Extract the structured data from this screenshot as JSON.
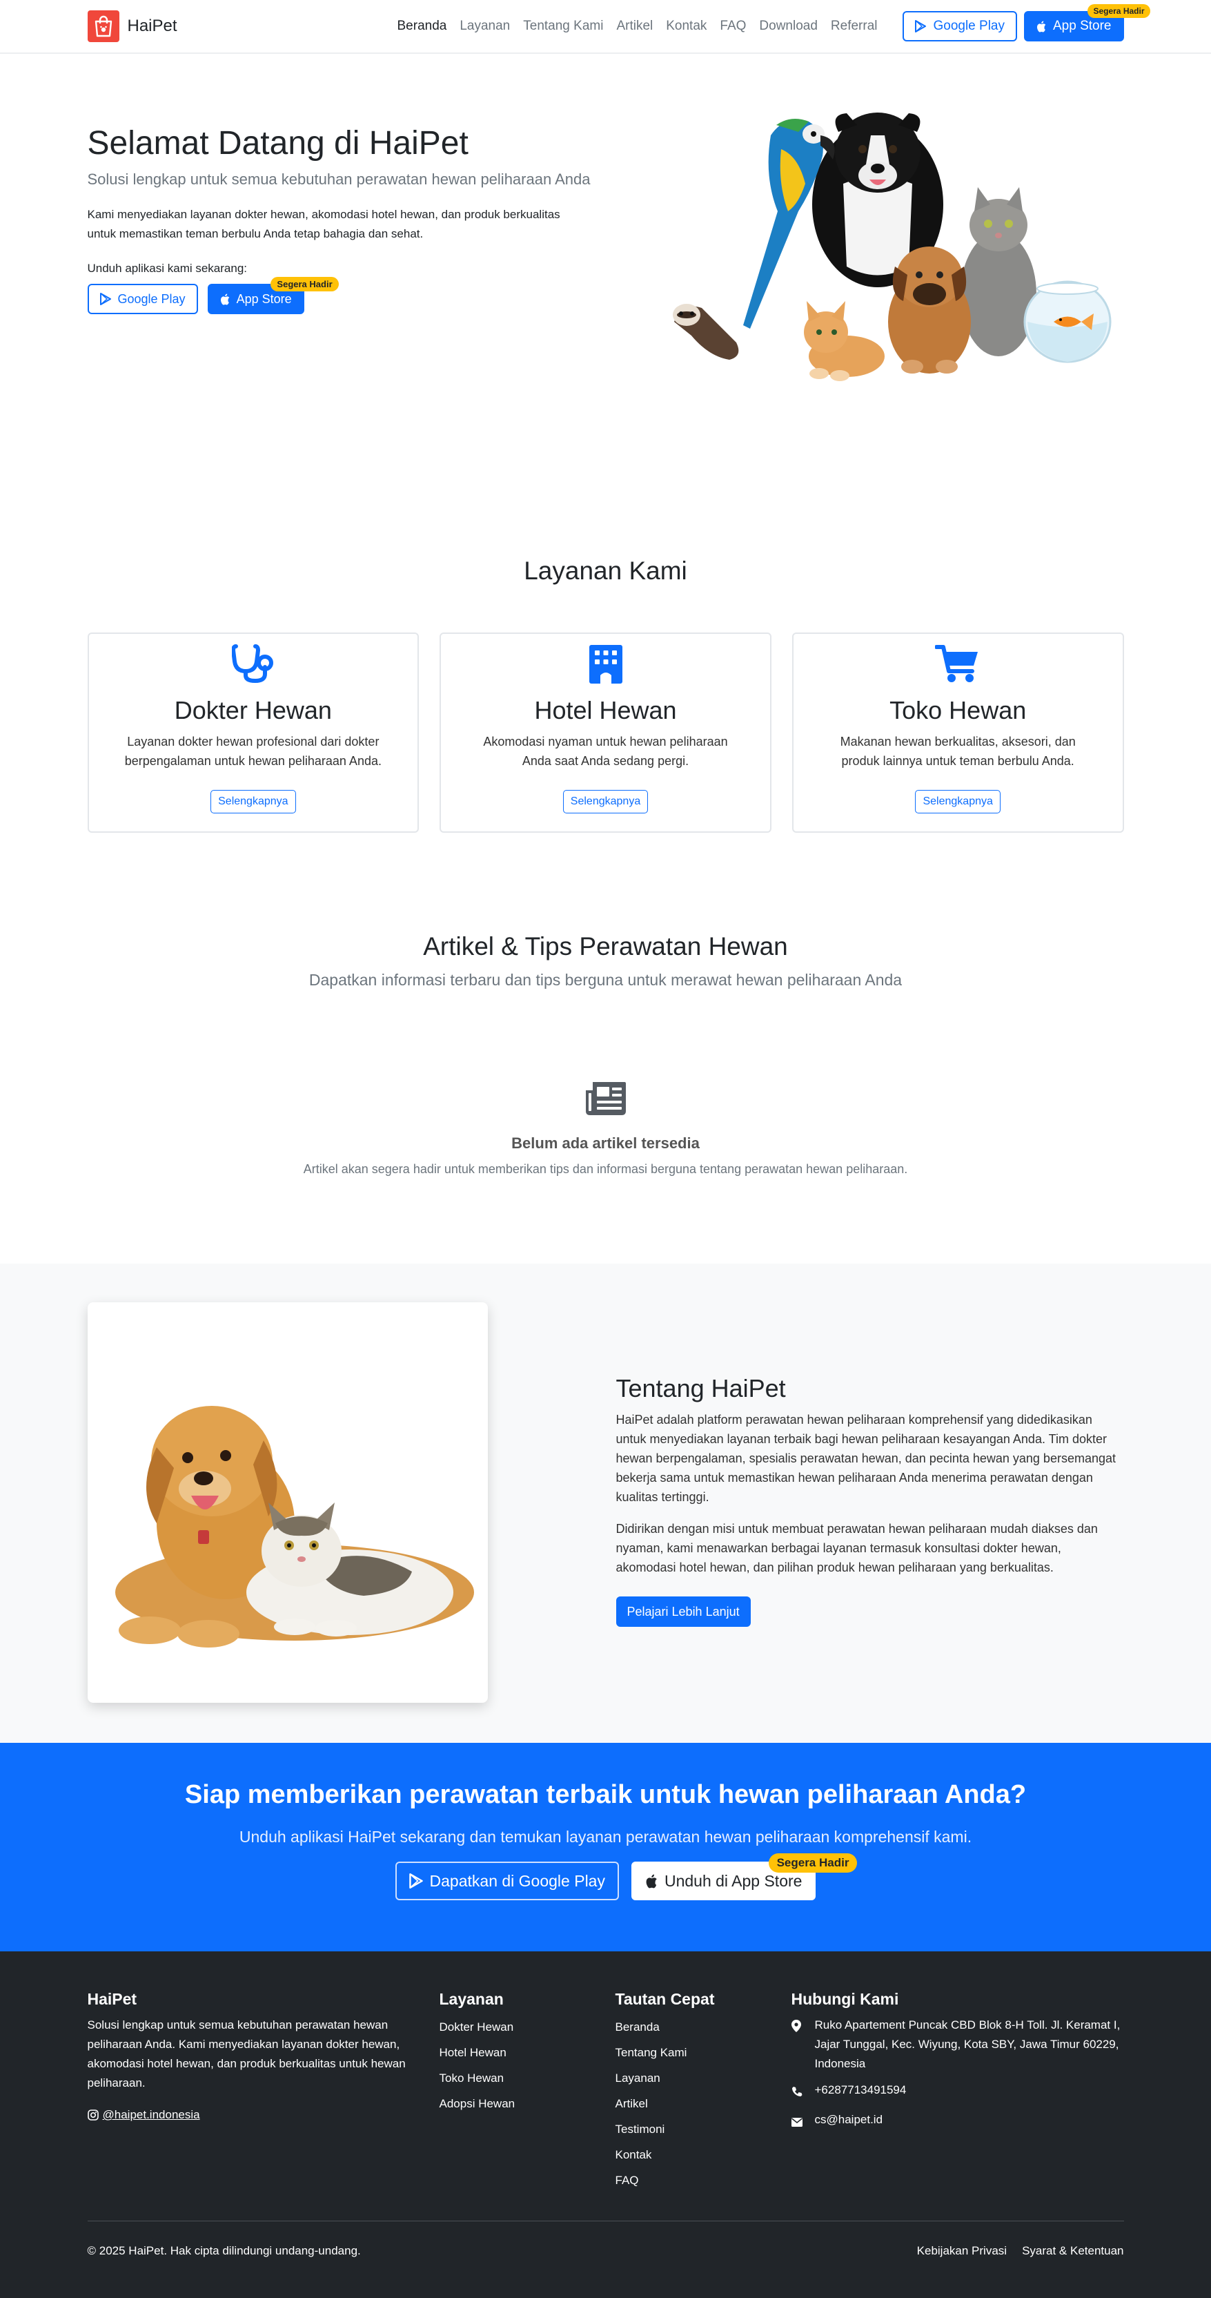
{
  "colors": {
    "primary": "#0d6efd",
    "badge": "#ffc107",
    "brand": "#f0473b",
    "footer_bg": "#212529",
    "light_bg": "#f8f9fa"
  },
  "brand": {
    "name": "HaiPet",
    "icon": "shopping-bag-icon"
  },
  "nav": {
    "links": [
      "Beranda",
      "Layanan",
      "Tentang Kami",
      "Artikel",
      "Kontak",
      "FAQ",
      "Download",
      "Referral"
    ],
    "active": "Beranda",
    "google_play": "Google Play",
    "app_store": "App Store",
    "badge": "Segera Hadir"
  },
  "hero": {
    "title": "Selamat Datang di HaiPet",
    "subtitle": "Solusi lengkap untuk semua kebutuhan perawatan hewan peliharaan Anda",
    "description": "Kami menyediakan layanan dokter hewan, akomodasi hotel hewan, dan produk berkualitas untuk memastikan teman berbulu Anda tetap bahagia dan sehat.",
    "download_label": "Unduh aplikasi kami sekarang:",
    "google_play": "Google Play",
    "app_store": "App Store",
    "badge": "Segera Hadir"
  },
  "services": {
    "title": "Layanan Kami",
    "items": [
      {
        "icon": "stethoscope-icon",
        "title": "Dokter Hewan",
        "description": "Layanan dokter hewan profesional dari dokter berpengalaman untuk hewan peliharaan Anda.",
        "button": "Selengkapnya"
      },
      {
        "icon": "building-icon",
        "title": "Hotel Hewan",
        "description": "Akomodasi nyaman untuk hewan peliharaan Anda saat Anda sedang pergi.",
        "button": "Selengkapnya"
      },
      {
        "icon": "cart-icon",
        "title": "Toko Hewan",
        "description": "Makanan hewan berkualitas, aksesori, dan produk lainnya untuk teman berbulu Anda.",
        "button": "Selengkapnya"
      }
    ]
  },
  "articles": {
    "title": "Artikel & Tips Perawatan Hewan",
    "subtitle": "Dapatkan informasi terbaru dan tips berguna untuk merawat hewan peliharaan Anda",
    "empty_icon": "newspaper-icon",
    "empty_title": "Belum ada artikel tersedia",
    "empty_description": "Artikel akan segera hadir untuk memberikan tips dan informasi berguna tentang perawatan hewan peliharaan."
  },
  "about": {
    "title": "Tentang HaiPet",
    "paragraph1": "HaiPet adalah platform perawatan hewan peliharaan komprehensif yang didedikasikan untuk menyediakan layanan terbaik bagi hewan peliharaan kesayangan Anda. Tim dokter hewan berpengalaman, spesialis perawatan hewan, dan pecinta hewan yang bersemangat bekerja sama untuk memastikan hewan peliharaan Anda menerima perawatan dengan kualitas tertinggi.",
    "paragraph2": "Didirikan dengan misi untuk membuat perawatan hewan peliharaan mudah diakses dan nyaman, kami menawarkan berbagai layanan termasuk konsultasi dokter hewan, akomodasi hotel hewan, dan pilihan produk hewan peliharaan yang berkualitas.",
    "button": "Pelajari Lebih Lanjut"
  },
  "cta": {
    "title": "Siap memberikan perawatan terbaik untuk hewan peliharaan Anda?",
    "subtitle": "Unduh aplikasi HaiPet sekarang dan temukan layanan perawatan hewan peliharaan komprehensif kami.",
    "google_play": "Dapatkan di Google Play",
    "app_store": "Unduh di App Store",
    "badge": "Segera Hadir"
  },
  "footer": {
    "brand_title": "HaiPet",
    "brand_description": "Solusi lengkap untuk semua kebutuhan perawatan hewan peliharaan Anda. Kami menyediakan layanan dokter hewan, akomodasi hotel hewan, dan produk berkualitas untuk hewan peliharaan.",
    "instagram": "@haipet.indonesia",
    "services_title": "Layanan",
    "services": [
      "Dokter Hewan",
      "Hotel Hewan",
      "Toko Hewan",
      "Adopsi Hewan"
    ],
    "links_title": "Tautan Cepat",
    "links": [
      "Beranda",
      "Tentang Kami",
      "Layanan",
      "Artikel",
      "Testimoni",
      "Kontak",
      "FAQ"
    ],
    "contact_title": "Hubungi Kami",
    "address": "Ruko Apartement Puncak CBD Blok 8-H Toll. Jl. Keramat I, Jajar Tunggal, Kec. Wiyung, Kota SBY, Jawa Timur 60229, Indonesia",
    "phone": "+6287713491594",
    "email": "cs@haipet.id",
    "copyright": "© 2025 HaiPet. Hak cipta dilindungi undang-undang.",
    "privacy": "Kebijakan Privasi",
    "terms": "Syarat & Ketentuan"
  }
}
